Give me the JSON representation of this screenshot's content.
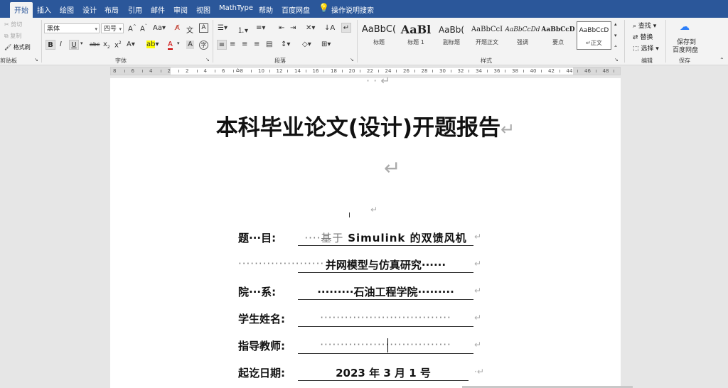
{
  "tabs": [
    "开始",
    "插入",
    "绘图",
    "设计",
    "布局",
    "引用",
    "邮件",
    "审阅",
    "视图",
    "MathType",
    "帮助",
    "百度网盘"
  ],
  "tell_me": "操作说明搜索",
  "clipboard": {
    "cut": "剪切",
    "copy": "复制",
    "format_painter": "格式刷",
    "group": "剪贴板"
  },
  "font": {
    "name": "黑体",
    "size": "四号",
    "group": "字体"
  },
  "paragraph": {
    "group": "段落"
  },
  "styles": {
    "group": "样式",
    "items": [
      {
        "sample": "AaBbC(",
        "name": "标题"
      },
      {
        "sample": "AaBl",
        "name": "标题 1"
      },
      {
        "sample": "AaBb(",
        "name": "副标题"
      },
      {
        "sample": "AaBbCcI",
        "name": "开题正文"
      },
      {
        "sample": "AaBbCcDd",
        "name": "强调"
      },
      {
        "sample": "AaBbCcD",
        "name": "要点"
      },
      {
        "sample": "AaBbCcD",
        "name": "正文"
      }
    ]
  },
  "editing": {
    "find": "查找",
    "replace": "替换",
    "select": "选择",
    "group": "编辑"
  },
  "save": {
    "label1": "保存到",
    "label2": "百度网盘",
    "group": "保存"
  },
  "ruler_numbers": [
    "8",
    "6",
    "4",
    "2",
    "2",
    "4",
    "6",
    "8",
    "10",
    "12",
    "14",
    "16",
    "18",
    "20",
    "22",
    "24",
    "26",
    "28",
    "30",
    "32",
    "34",
    "36",
    "38",
    "40",
    "42",
    "44",
    "46",
    "48"
  ],
  "document": {
    "title": "本科毕业论文(设计)开题报告",
    "fields": [
      {
        "label": "题···目:",
        "value": "····基于 Simulink 的双馈风机"
      },
      {
        "label": "·····················",
        "value": "并网模型与仿真研究······"
      },
      {
        "label": "院···系:",
        "value": "·········石油工程学院·········"
      },
      {
        "label": "学生姓名:",
        "value": "································"
      },
      {
        "label": "指导教师:",
        "value": "································"
      },
      {
        "label": "起讫日期:",
        "value": "2023 年 3 月 1 号"
      }
    ]
  }
}
